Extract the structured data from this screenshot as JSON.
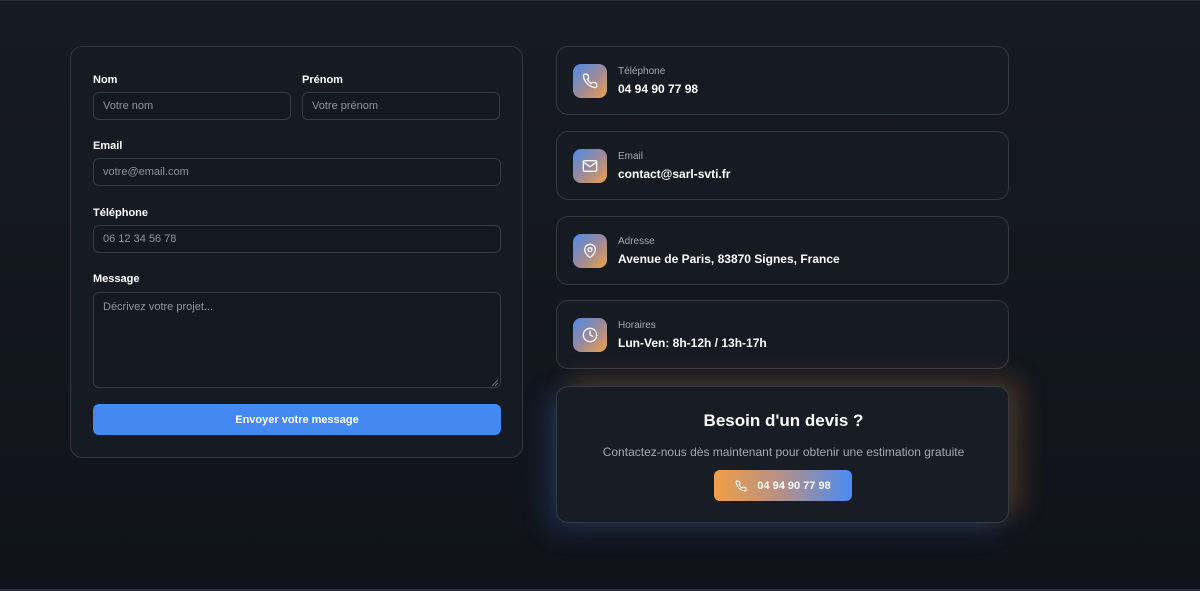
{
  "form": {
    "nom_label": "Nom",
    "nom_placeholder": "Votre nom",
    "prenom_label": "Prénom",
    "prenom_placeholder": "Votre prénom",
    "email_label": "Email",
    "email_placeholder": "votre@email.com",
    "telephone_label": "Téléphone",
    "telephone_placeholder": "06 12 34 56 78",
    "message_label": "Message",
    "message_placeholder": "Décrivez votre projet...",
    "submit_label": "Envoyer votre message"
  },
  "contact": {
    "items": [
      {
        "icon": "phone-icon",
        "label": "Téléphone",
        "value": "04 94 90 77 98"
      },
      {
        "icon": "mail-icon",
        "label": "Email",
        "value": "contact@sarl-svti.fr"
      },
      {
        "icon": "map-pin-icon",
        "label": "Adresse",
        "value": "Avenue de Paris, 83870 Signes, France"
      },
      {
        "icon": "clock-icon",
        "label": "Horaires",
        "value": "Lun-Ven: 8h-12h / 13h-17h"
      }
    ]
  },
  "quote": {
    "title": "Besoin d'un devis ?",
    "subtitle": "Contactez-nous dès maintenant pour obtenir une estimation gratuite",
    "button_label": "04 94 90 77 98"
  },
  "colors": {
    "background": "#12151c",
    "card": "#161a22",
    "border": "#323844",
    "primary_blue": "#4489f2",
    "accent_orange": "#f09e45",
    "muted_text": "#a3a9b4"
  }
}
